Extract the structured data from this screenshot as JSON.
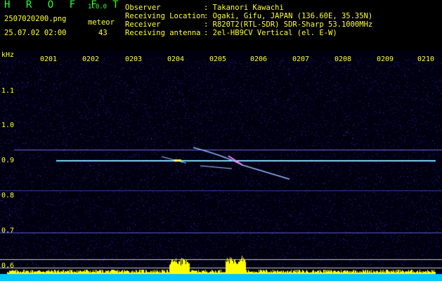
{
  "header": {
    "brand": "H R O F F T",
    "version": "1.0.0",
    "filename": "2507020200.png",
    "meteor_label": "meteor",
    "datetime": "25.07.02 02:00",
    "meteor_count": "43"
  },
  "meta": [
    {
      "label": "Observer",
      "value": ": Takanori Kawachi"
    },
    {
      "label": "Receiving Location",
      "value": ": Ogaki, Gifu, JAPAN (136.60E, 35.35N)"
    },
    {
      "label": "Receiver",
      "value": ": R820T2(RTL-SDR) SDR-Sharp 53.1000MHz"
    },
    {
      "label": "Receiving antenna",
      "value": ": 2el-HB9CV Vertical (el. E-W)"
    }
  ],
  "axes": {
    "unit": "kHz",
    "x_ticks": [
      "0201",
      "0202",
      "0203",
      "0204",
      "0205",
      "0206",
      "0207",
      "0208",
      "0209",
      "0210"
    ],
    "y_ticks": [
      "1.1",
      "1.0",
      "0.9",
      "0.8",
      "0.7",
      "0.6"
    ]
  },
  "colors": {
    "background": "#000000",
    "noise": "#1a1a6e",
    "carrier": "#3fc8ff",
    "echo": "#ffffff",
    "bars": "#ffff00",
    "baseline": "#00c8ff",
    "label": "#ffff33",
    "brand": "#2dff2d"
  }
}
